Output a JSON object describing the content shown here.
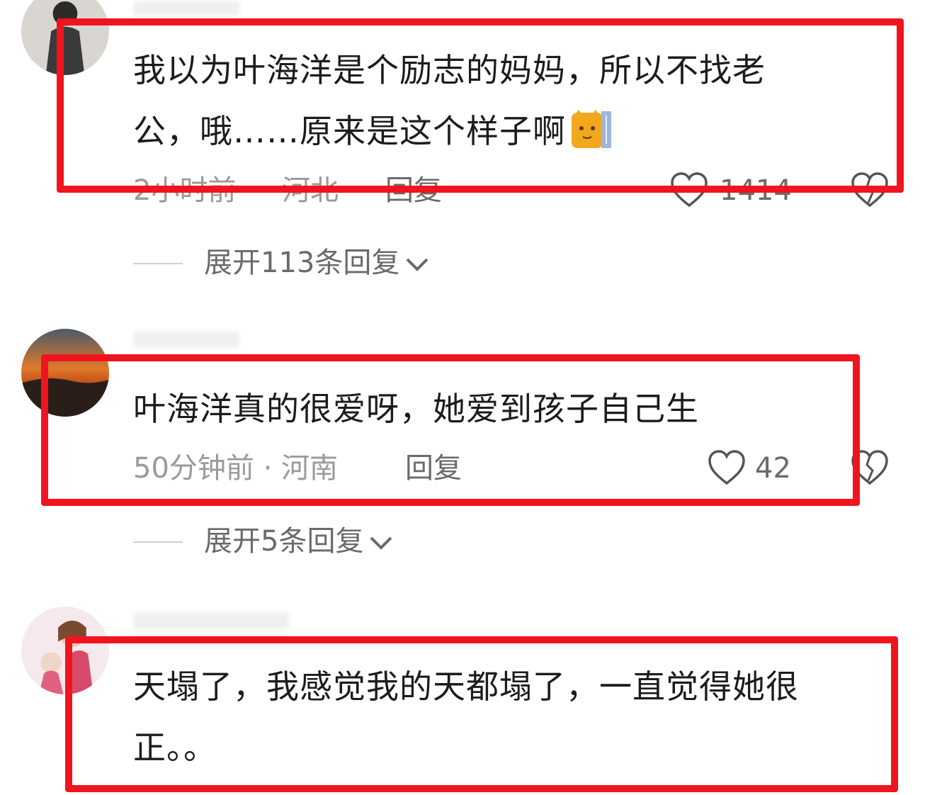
{
  "comments": [
    {
      "text_line1": "我以为叶海洋是个励志的妈妈，所以不找老",
      "text_line2": "公，哦……原来是这个样子啊",
      "emoji": "cat-emoji",
      "time": "2小时前",
      "location": "河北",
      "reply_label": "回复",
      "likes": "1414",
      "expand_label": "展开113条回复"
    },
    {
      "text_line1": "叶海洋真的很爱呀，她爱到孩子自己生",
      "time_location": "50分钟前 · 河南",
      "reply_label": "回复",
      "likes": "42",
      "expand_label": "展开5条回复"
    },
    {
      "text_line1": "天塌了，我感觉我的天都塌了，一直觉得她很",
      "text_line2": "正。。"
    }
  ],
  "highlight_color": "#f0141e",
  "icons": [
    "heart-icon",
    "broken-heart-icon",
    "chevron-down-icon"
  ]
}
